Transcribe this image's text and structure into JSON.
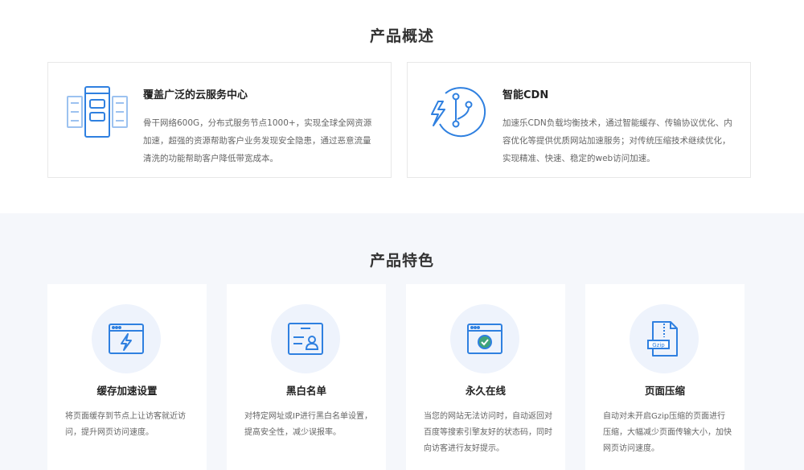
{
  "overview": {
    "title": "产品概述",
    "cards": [
      {
        "icon": "cloud-server-icon",
        "title": "覆盖广泛的云服务中心",
        "desc": "骨干网络600G，分布式服务节点1000+，实现全球全网资源加速，超强的资源帮助客户业务发现安全隐患，通过恶意流量清洗的功能帮助客户降低带宽成本。"
      },
      {
        "icon": "smart-cdn-icon",
        "title": "智能CDN",
        "desc": "加速乐CDN负载均衡技术，通过智能缓存、传输协议优化、内容优化等提供优质网站加速服务；对传统压缩技术继续优化，实现精准、快速、稳定的web访问加速。"
      }
    ]
  },
  "features": {
    "title": "产品特色",
    "cards": [
      {
        "icon": "cache-lightning-icon",
        "title": "缓存加速设置",
        "desc": "将页面缓存到节点上让访客就近访问，提升网页访问速度。"
      },
      {
        "icon": "id-card-icon",
        "title": "黑白名单",
        "desc": "对特定网址或IP进行黑白名单设置，提高安全性，减少误报率。"
      },
      {
        "icon": "browser-check-icon",
        "title": "永久在线",
        "desc": "当您的网站无法访问时，自动返回对百度等搜索引擎友好的状态码，同时向访客进行友好提示。"
      },
      {
        "icon": "gzip-file-icon",
        "title": "页面压缩",
        "desc": "自动对未开启Gzip压缩的页面进行压缩，大幅减少页面传输大小，加快网页访问速度。"
      }
    ]
  },
  "colors": {
    "accent": "#2f80e0",
    "light": "#eef3fc",
    "bg": "#f5f7fb"
  }
}
